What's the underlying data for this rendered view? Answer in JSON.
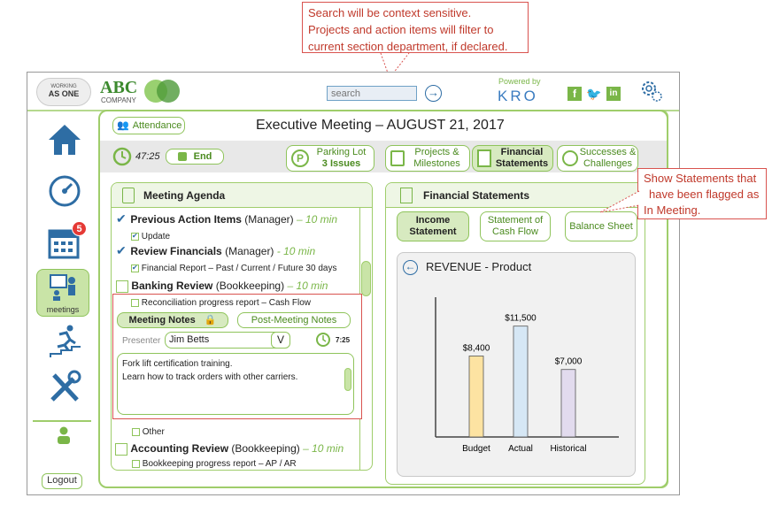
{
  "callouts": {
    "search_lines": [
      "Search will be context sensitive.",
      "Projects and action items will filter to",
      "current section department, if declared."
    ],
    "statements_lines": [
      "Show Statements that",
      "have been flagged as",
      "In Meeting."
    ]
  },
  "header": {
    "logo_top": "WORKING",
    "logo_bottom": "AS ONE",
    "company": "ABC",
    "company_sub": "COMPANY",
    "search_placeholder": "search",
    "powered_by": "Powered by",
    "kro": "KRO"
  },
  "sidebar": {
    "badge": "5",
    "meetings_label": "meetings",
    "logout": "Logout"
  },
  "meeting": {
    "attendance": "Attendance",
    "title": "Executive Meeting – AUGUST 21, 2017",
    "timer": "47:25",
    "end_label": "End",
    "tabs": [
      {
        "line1": "Parking Lot",
        "line2": "3 Issues"
      },
      {
        "line1": "Projects &",
        "line2": "Milestones"
      },
      {
        "line1": "Financial",
        "line2": "Statements"
      },
      {
        "line1": "Successes &",
        "line2": "Challenges"
      }
    ]
  },
  "agenda": {
    "heading": "Meeting Agenda",
    "items": [
      {
        "title": "Previous Action Items",
        "role": "(Manager)",
        "time": "– 10 min",
        "sub": "Update"
      },
      {
        "title": "Review Financials",
        "role": "(Manager)",
        "time": "- 10 min",
        "sub": "Financial Report – Past / Current / Future 30 days"
      },
      {
        "title": "Banking Review",
        "role": "(Bookkeeping)",
        "time": "– 10 min",
        "sub": "Reconciliation progress report – Cash Flow"
      }
    ],
    "notes_tab": "Meeting Notes",
    "post_notes_tab": "Post-Meeting Notes",
    "presenter_label": "Presenter",
    "presenter_value": "Jim Betts",
    "presenter_chevron": "V",
    "presenter_time": "7:25",
    "notes_lines": [
      "Fork lift certification training.",
      "Learn how to track orders with other carriers."
    ],
    "other": "Other",
    "accounting": {
      "title": "Accounting Review",
      "role": "(Bookkeeping)",
      "time": "– 10 min",
      "sub": "Bookkeeping progress report – AP / AR"
    }
  },
  "financial": {
    "heading": "Financial Statements",
    "tabs": [
      {
        "line1": "Income",
        "line2": "Statement"
      },
      {
        "line1": "Statement of",
        "line2": "Cash Flow"
      },
      {
        "line1": "Balance Sheet",
        "line2": ""
      }
    ],
    "chart_title": "REVENUE - Product"
  },
  "chart_data": {
    "type": "bar",
    "title": "REVENUE - Product",
    "categories": [
      "Budget",
      "Actual",
      "Historical"
    ],
    "values": [
      8400,
      11500,
      7000
    ],
    "value_labels": [
      "$8,400",
      "$11,500",
      "$7,000"
    ],
    "colors": [
      "#fde3a2",
      "#d6e7f5",
      "#e2dbee"
    ],
    "ylim": [
      0,
      14500
    ]
  }
}
